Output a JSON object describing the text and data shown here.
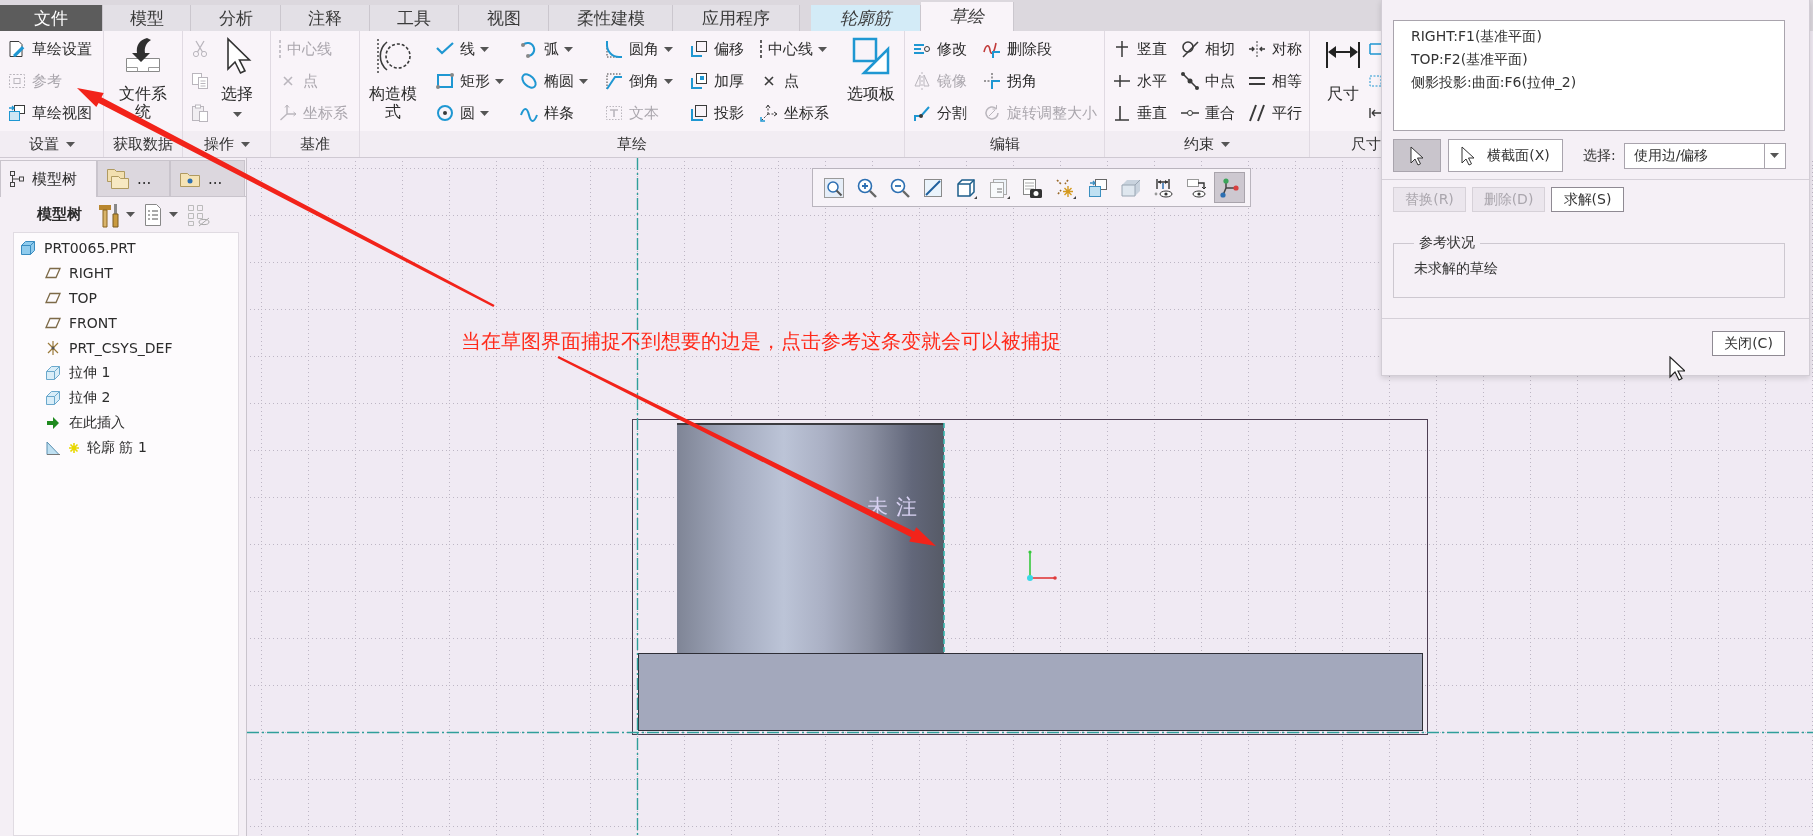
{
  "tabs": [
    {
      "label": "文件",
      "kind": "file",
      "selected": false
    },
    {
      "label": "模型",
      "kind": "standard",
      "selected": false
    },
    {
      "label": "分析",
      "kind": "standard",
      "selected": false
    },
    {
      "label": "注释",
      "kind": "standard",
      "selected": false
    },
    {
      "label": "工具",
      "kind": "standard",
      "selected": false
    },
    {
      "label": "视图",
      "kind": "standard",
      "selected": false
    },
    {
      "label": "柔性建模",
      "kind": "standard",
      "selected": false
    },
    {
      "label": "应用程序",
      "kind": "standard",
      "selected": false
    },
    {
      "label": "轮廓筋",
      "kind": "contextual",
      "selected": false
    },
    {
      "label": "草绘",
      "kind": "contextual",
      "selected": true
    }
  ],
  "ribbon": {
    "groups": [
      {
        "label": "设置",
        "menu": true,
        "columns": [
          {
            "kind": "stack",
            "items": [
              {
                "label": "草绘设置",
                "dropdown": false,
                "disabled": false
              },
              {
                "label": "参考",
                "dropdown": false,
                "disabled": true
              },
              {
                "label": "草绘视图",
                "dropdown": false,
                "disabled": false
              }
            ]
          }
        ]
      },
      {
        "label": "获取数据",
        "menu": false,
        "columns": [
          {
            "kind": "large",
            "label": "文件系统",
            "disabled": false
          }
        ]
      },
      {
        "label": "操作",
        "menu": true,
        "columns": [
          {
            "kind": "stack",
            "items": [
              {
                "dropdown": false,
                "disabled": true
              },
              {
                "dropdown": false,
                "disabled": true
              },
              {
                "dropdown": false,
                "disabled": true
              }
            ]
          },
          {
            "kind": "large",
            "label": "选择",
            "dropdown": true,
            "disabled": false
          }
        ]
      },
      {
        "label": "基准",
        "menu": false,
        "columns": [
          {
            "kind": "stack",
            "items": [
              {
                "label": "中心线",
                "dropdown": false,
                "disabled": true
              },
              {
                "label": "点",
                "dropdown": false,
                "disabled": true
              },
              {
                "label": "坐标系",
                "dropdown": false,
                "disabled": true
              }
            ]
          }
        ]
      },
      {
        "label": "草绘",
        "menu": false,
        "columns": [
          {
            "kind": "large",
            "label": "构造模式",
            "dropdown": false,
            "disabled": false
          },
          {
            "kind": "stack",
            "items": [
              {
                "label": "线",
                "dropdown": true,
                "disabled": false
              },
              {
                "label": "矩形",
                "dropdown": true,
                "disabled": false
              },
              {
                "label": "圆",
                "dropdown": true,
                "disabled": false
              }
            ]
          },
          {
            "kind": "stack",
            "items": [
              {
                "label": "弧",
                "dropdown": true,
                "disabled": false
              },
              {
                "label": "椭圆",
                "dropdown": true,
                "disabled": false
              },
              {
                "label": "样条",
                "dropdown": false,
                "disabled": false
              }
            ]
          },
          {
            "kind": "stack",
            "items": [
              {
                "label": "圆角",
                "dropdown": true,
                "disabled": false
              },
              {
                "label": "倒角",
                "dropdown": true,
                "disabled": false
              },
              {
                "label": "文本",
                "dropdown": false,
                "disabled": true
              }
            ]
          },
          {
            "kind": "stack",
            "items": [
              {
                "label": "偏移",
                "dropdown": false,
                "disabled": false
              },
              {
                "label": "加厚",
                "dropdown": false,
                "disabled": false
              },
              {
                "label": "投影",
                "dropdown": false,
                "disabled": false
              }
            ]
          },
          {
            "kind": "stack",
            "items": [
              {
                "label": "中心线",
                "dropdown": true,
                "disabled": false
              },
              {
                "label": "点",
                "dropdown": false,
                "disabled": false
              },
              {
                "label": "坐标系",
                "dropdown": false,
                "disabled": false
              }
            ]
          },
          {
            "kind": "large",
            "label": "选项板",
            "dropdown": false,
            "disabled": false
          }
        ]
      },
      {
        "label": "编辑",
        "menu": false,
        "columns": [
          {
            "kind": "stack",
            "items": [
              {
                "label": "修改",
                "dropdown": false,
                "disabled": false
              },
              {
                "label": "镜像",
                "dropdown": false,
                "disabled": true
              },
              {
                "label": "分割",
                "dropdown": false,
                "disabled": false
              }
            ]
          },
          {
            "kind": "stack",
            "items": [
              {
                "label": "删除段",
                "dropdown": false,
                "disabled": false
              },
              {
                "label": "拐角",
                "dropdown": false,
                "disabled": false
              },
              {
                "label": "旋转调整大小",
                "dropdown": false,
                "disabled": true
              }
            ]
          }
        ]
      },
      {
        "label": "约束",
        "menu": true,
        "columns": [
          {
            "kind": "stack",
            "items": [
              {
                "label": "竖直",
                "dropdown": false,
                "disabled": false
              },
              {
                "label": "水平",
                "dropdown": false,
                "disabled": false
              },
              {
                "label": "垂直",
                "dropdown": false,
                "disabled": false
              }
            ]
          },
          {
            "kind": "stack",
            "items": [
              {
                "label": "相切",
                "dropdown": false,
                "disabled": false
              },
              {
                "label": "中点",
                "dropdown": false,
                "disabled": false
              },
              {
                "label": "重合",
                "dropdown": false,
                "disabled": false
              }
            ]
          },
          {
            "kind": "stack",
            "items": [
              {
                "label": "对称",
                "dropdown": false,
                "disabled": false
              },
              {
                "label": "相等",
                "dropdown": false,
                "disabled": false
              },
              {
                "label": "平行",
                "dropdown": false,
                "disabled": false
              }
            ]
          }
        ]
      },
      {
        "label": "尺寸",
        "menu": false,
        "columns": [
          {
            "kind": "large",
            "label": "尺寸",
            "dropdown": false,
            "disabled": false
          },
          {
            "kind": "stack",
            "items": [
              {
                "dropdown": false,
                "disabled": false
              },
              {
                "dropdown": false,
                "disabled": false
              },
              {
                "dropdown": false,
                "disabled": false
              }
            ]
          }
        ]
      }
    ]
  },
  "left_panel": {
    "tabs": [
      {
        "label": "模型树",
        "selected": true
      },
      {
        "label": "...",
        "selected": false
      },
      {
        "label": "...",
        "selected": false
      }
    ],
    "title": "模型树",
    "tree": {
      "label": "PRT0065.PRT",
      "kind": "part",
      "children": [
        {
          "label": "RIGHT",
          "kind": "plane"
        },
        {
          "label": "TOP",
          "kind": "plane"
        },
        {
          "label": "FRONT",
          "kind": "plane"
        },
        {
          "label": "PRT_CSYS_DEF",
          "kind": "csys"
        },
        {
          "label": "拉伸 1",
          "kind": "extrude"
        },
        {
          "label": "拉伸 2",
          "kind": "extrude"
        },
        {
          "label": "在此插入",
          "kind": "insert"
        },
        {
          "label": "轮廓 筋 1",
          "kind": "rib"
        }
      ]
    }
  },
  "view_toolbar": {
    "buttons": [
      {
        "selected": false
      },
      {
        "selected": false
      },
      {
        "selected": false
      },
      {
        "selected": false
      },
      {
        "selected": false
      },
      {
        "selected": false
      },
      {
        "selected": false
      },
      {
        "selected": false
      },
      {
        "selected": false
      },
      {
        "selected": false
      },
      {
        "selected": false
      },
      {
        "selected": false
      },
      {
        "selected": true
      }
    ]
  },
  "canvas": {
    "model_text": "未注"
  },
  "annotation": {
    "text": "当在草图界面捕捉不到想要的边是，点击参考这条变就会可以被捕捉"
  },
  "dialog": {
    "references": [
      "RIGHT:F1(基准平面)",
      "TOP:F2(基准平面)",
      "侧影投影:曲面:F6(拉伸_2)"
    ],
    "pick_button": {
      "selected": true
    },
    "cross_section_button": "横截面(X)",
    "select_label": "选择:",
    "select_value": "使用边/偏移",
    "actions": [
      {
        "label": "替换(R)",
        "disabled": true
      },
      {
        "label": "删除(D)",
        "disabled": true
      },
      {
        "label": "求解(S)",
        "disabled": false
      }
    ],
    "status_group": {
      "title": "参考状况",
      "text": "未求解的草绘"
    },
    "close_button": "关闭(C)"
  }
}
